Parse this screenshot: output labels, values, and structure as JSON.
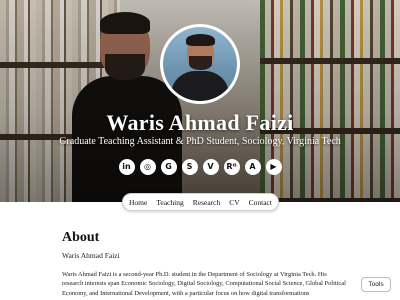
{
  "hero": {
    "name": "Waris Ahmad Faizi",
    "subtitle": "Graduate Teaching Assistant & PhD Student, Sociology, Virginia Tech",
    "social": [
      {
        "icon": "linkedin-icon",
        "glyph": "in"
      },
      {
        "icon": "orcid-icon",
        "glyph": "◎"
      },
      {
        "icon": "google-scholar-icon",
        "glyph": "G"
      },
      {
        "icon": "ssrn-icon",
        "glyph": "S"
      },
      {
        "icon": "vt-icon",
        "glyph": "V"
      },
      {
        "icon": "researchgate-icon",
        "glyph": "Rᴳ"
      },
      {
        "icon": "academia-icon",
        "glyph": "A"
      },
      {
        "icon": "youtube-icon",
        "glyph": "▶"
      }
    ]
  },
  "nav": {
    "items": [
      "Home",
      "Teaching",
      "Research",
      "CV",
      "Contact"
    ]
  },
  "about": {
    "heading": "About",
    "subheading": "Waris Ahmad Faizi",
    "body": "Waris Ahmad Faizi is a second-year Ph.D. student in the Department of Sociology at Virginia Tech. His research interests span Economic Sociology, Digital Sociology, Computational Social Science, Global Political Economy, and International Development, with a particular focus on how digital transformations"
  },
  "tools": {
    "label": "Tools"
  }
}
